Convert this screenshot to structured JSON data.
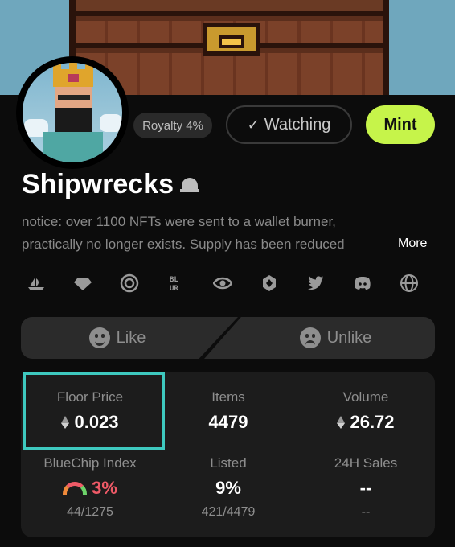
{
  "header": {
    "royalty_label": "Royalty 4%",
    "watching_label": "Watching",
    "mint_label": "Mint"
  },
  "collection": {
    "name": "Shipwrecks",
    "description_line1": "notice: over 1100 NFTs were sent to a wallet burner,",
    "description_line2": "practically no longer exists. Supply has been reduced",
    "more_label": "More"
  },
  "social_icons": [
    "opensea-icon",
    "diamond-icon",
    "looksrare-icon",
    "blur-icon",
    "x2y2-icon",
    "element-icon",
    "twitter-icon",
    "discord-icon",
    "globe-icon"
  ],
  "blur_text": "BL\nUR",
  "reactions": {
    "like_label": "Like",
    "unlike_label": "Unlike"
  },
  "stats": {
    "floor_price": {
      "label": "Floor Price",
      "value": "0.023"
    },
    "items": {
      "label": "Items",
      "value": "4479"
    },
    "volume": {
      "label": "Volume",
      "value": "26.72"
    },
    "bluechip": {
      "label": "BlueChip Index",
      "value": "3%",
      "sub": "44/1275"
    },
    "listed": {
      "label": "Listed",
      "value": "9%",
      "sub": "421/4479"
    },
    "sales_24h": {
      "label": "24H Sales",
      "value": "--",
      "sub": "--"
    }
  },
  "colors": {
    "mint": "#c6f44a",
    "highlight": "#3ec9bf",
    "bluechip": "#ef5a67"
  }
}
